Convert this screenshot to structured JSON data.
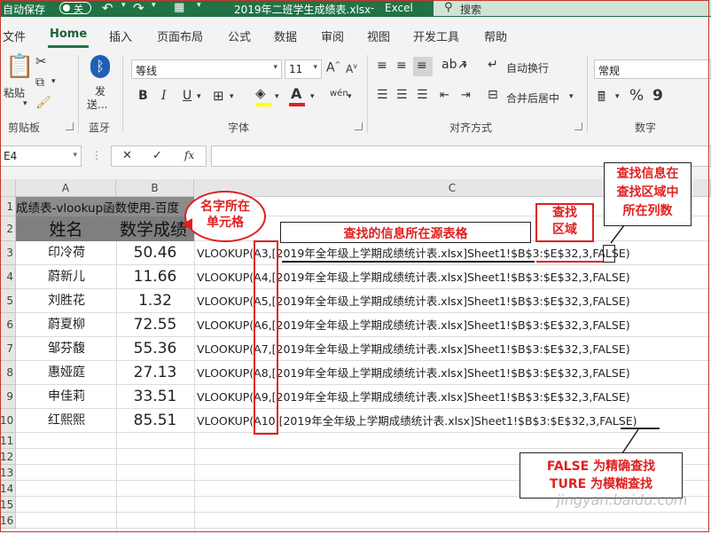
{
  "titlebar": {
    "autosave_label": "自动保存",
    "autosave_state": "关",
    "filename": "2019年二班学生成绩表.xlsx",
    "app_name": "Excel",
    "search_placeholder": "搜索"
  },
  "tabs": [
    "文件",
    "Home",
    "插入",
    "页面布局",
    "公式",
    "数据",
    "审阅",
    "视图",
    "开发工具",
    "帮助"
  ],
  "ribbon": {
    "clipboard": {
      "paste": "粘贴",
      "label": "剪贴板"
    },
    "bluetooth": {
      "send_1": "发",
      "send_2": "送...",
      "label": "蓝牙"
    },
    "font": {
      "name": "等线",
      "size": "11",
      "grow": "A",
      "shrink": "A",
      "bold": "B",
      "italic": "I",
      "underline": "U",
      "label": "字体"
    },
    "alignment": {
      "wrap": "自动换行",
      "merge": "合并后居中",
      "label": "对齐方式"
    },
    "number": {
      "format": "常规",
      "percent": "%",
      "comma": "9",
      "label": "数字"
    }
  },
  "formula_bar": {
    "cell_ref": "E4",
    "fx": "fx",
    "value": ""
  },
  "columns": [
    "A",
    "B",
    "C"
  ],
  "rows": [
    "1",
    "2",
    "3",
    "4",
    "5",
    "6",
    "7",
    "8",
    "9",
    "10",
    "11",
    "12",
    "13",
    "14",
    "15",
    "16"
  ],
  "sheet": {
    "row1": "成绩表-vlookup函数使用-百度",
    "header_name": "姓名",
    "header_score": "数学成绩",
    "data": [
      {
        "name": "印冷荷",
        "score": "50.46",
        "ref": "A3",
        "formula": "VLOOKUP(A3,[2019年全年级上学期成绩统计表.xlsx]Sheet1!$B$3:$E$32,3,FALSE)"
      },
      {
        "name": "蔚新儿",
        "score": "11.66",
        "ref": "A4",
        "formula": "VLOOKUP(A4,[2019年全年级上学期成绩统计表.xlsx]Sheet1!$B$3:$E$32,3,FALSE)"
      },
      {
        "name": "刘胜花",
        "score": "1.32",
        "ref": "A5",
        "formula": "VLOOKUP(A5,[2019年全年级上学期成绩统计表.xlsx]Sheet1!$B$3:$E$32,3,FALSE)"
      },
      {
        "name": "蔚夏柳",
        "score": "72.55",
        "ref": "A6",
        "formula": "VLOOKUP(A6,[2019年全年级上学期成绩统计表.xlsx]Sheet1!$B$3:$E$32,3,FALSE)"
      },
      {
        "name": "邹芬馥",
        "score": "55.36",
        "ref": "A7",
        "formula": "VLOOKUP(A7,[2019年全年级上学期成绩统计表.xlsx]Sheet1!$B$3:$E$32,3,FALSE)"
      },
      {
        "name": "惠娅庭",
        "score": "27.13",
        "ref": "A8",
        "formula": "VLOOKUP(A8,[2019年全年级上学期成绩统计表.xlsx]Sheet1!$B$3:$E$32,3,FALSE)"
      },
      {
        "name": "申佳莉",
        "score": "33.51",
        "ref": "A9",
        "formula": "VLOOKUP(A9,[2019年全年级上学期成绩统计表.xlsx]Sheet1!$B$3:$E$32,3,FALSE)"
      },
      {
        "name": "红熙熙",
        "score": "85.51",
        "ref": "A10",
        "formula": "VLOOKUP(A10,[2019年全年级上学期成绩统计表.xlsx]Sheet1!$B$3:$E$32,3,FALSE)"
      }
    ]
  },
  "annotations": {
    "name_cell": "名字所在\n单元格",
    "source_table": "查找的信息所在源表格",
    "lookup_range": "查找\n区域",
    "column_index": "查找信息在\n查找区域中\n所在列数",
    "match_mode": "FALSE 为精确查找\nTURE 为模糊查找"
  },
  "watermark": "jingyan.baidu.com",
  "colors": {
    "excel_green": "#217346",
    "annotation_red": "#e02020",
    "header_fill": "#7f7f7f"
  }
}
